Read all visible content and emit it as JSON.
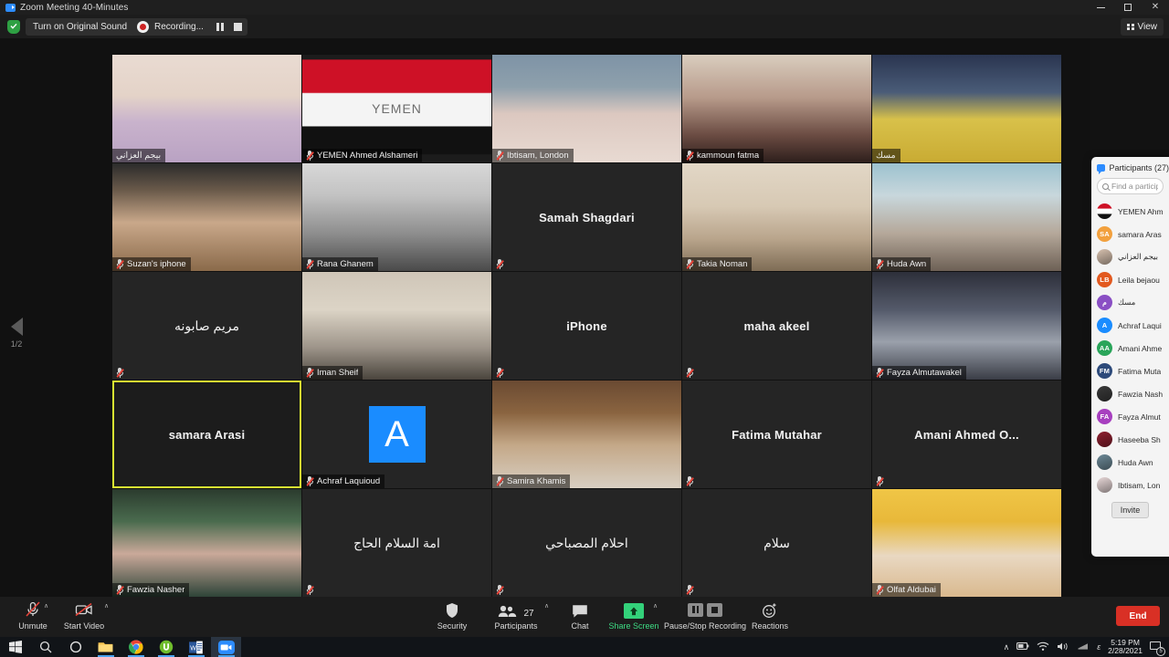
{
  "window": {
    "title": "Zoom Meeting 40-Minutes",
    "minimize_label": "Minimize",
    "maximize_label": "Restore",
    "close_label": "Close"
  },
  "top_toolbar": {
    "original_sound_label": "Turn on Original Sound",
    "original_sound_caret": "▾",
    "recording_label": "Recording...",
    "view_label": "View"
  },
  "stage": {
    "page_indicator": "1/2",
    "prev_page_label": "Previous page"
  },
  "tiles": [
    {
      "name": "بيجم العزاني",
      "rtl": true,
      "display": "bar",
      "muted": false,
      "video": true,
      "theme": "photo-a"
    },
    {
      "name": "YEMEN Ahmed Alshameri",
      "rtl": false,
      "display": "bar",
      "muted": true,
      "video": true,
      "theme": "yemen-flag"
    },
    {
      "name": "Ibtisam, London",
      "rtl": false,
      "display": "bar",
      "muted": true,
      "video": true,
      "theme": "photo-b"
    },
    {
      "name": "kammoun fatma",
      "rtl": false,
      "display": "bar",
      "muted": true,
      "video": true,
      "theme": "photo-c"
    },
    {
      "name": "مسك",
      "rtl": true,
      "display": "bar",
      "muted": false,
      "video": true,
      "theme": "photo-d"
    },
    {
      "name": "Suzan's iphone",
      "rtl": false,
      "display": "bar",
      "muted": true,
      "video": true,
      "theme": "photo-e"
    },
    {
      "name": "Rana Ghanem",
      "rtl": false,
      "display": "bar",
      "muted": true,
      "video": true,
      "theme": "photo-f"
    },
    {
      "name": "Samah Shagdari",
      "rtl": false,
      "display": "center",
      "muted": true,
      "video": false,
      "theme": "dark"
    },
    {
      "name": "Takia Noman",
      "rtl": false,
      "display": "bar",
      "muted": true,
      "video": true,
      "theme": "photo-g"
    },
    {
      "name": "Huda Awn",
      "rtl": false,
      "display": "bar",
      "muted": true,
      "video": true,
      "theme": "photo-h"
    },
    {
      "name": "مريم صابونه",
      "rtl": true,
      "display": "center",
      "muted": true,
      "video": false,
      "theme": "dark"
    },
    {
      "name": "Iman Sheif",
      "rtl": false,
      "display": "bar",
      "muted": true,
      "video": true,
      "theme": "photo-i"
    },
    {
      "name": "iPhone",
      "rtl": false,
      "display": "center",
      "muted": true,
      "video": false,
      "theme": "dark"
    },
    {
      "name": "maha akeel",
      "rtl": false,
      "display": "center",
      "muted": true,
      "video": false,
      "theme": "dark"
    },
    {
      "name": "Fayza Almutawakel",
      "rtl": false,
      "display": "bar",
      "muted": true,
      "video": true,
      "theme": "photo-j"
    },
    {
      "name": "samara Arasi",
      "rtl": false,
      "display": "center",
      "muted": false,
      "video": false,
      "theme": "dark",
      "active": true
    },
    {
      "name": "Achraf Laquioud",
      "rtl": false,
      "display": "bar",
      "muted": true,
      "video": false,
      "theme": "letter",
      "letter": "A"
    },
    {
      "name": "Samira Khamis",
      "rtl": false,
      "display": "bar",
      "muted": true,
      "video": true,
      "theme": "photo-k"
    },
    {
      "name": "Fatima Mutahar",
      "rtl": false,
      "display": "center",
      "muted": true,
      "video": false,
      "theme": "dark"
    },
    {
      "name": "Amani  Ahmed  O...",
      "rtl": false,
      "display": "center",
      "muted": true,
      "video": false,
      "theme": "dark"
    },
    {
      "name": "Fawzia Nasher",
      "rtl": false,
      "display": "bar",
      "muted": true,
      "video": true,
      "theme": "photo-l"
    },
    {
      "name": "امة السلام الحاج",
      "rtl": true,
      "display": "center",
      "muted": true,
      "video": false,
      "theme": "dark"
    },
    {
      "name": "احلام المصباحي",
      "rtl": true,
      "display": "center",
      "muted": true,
      "video": false,
      "theme": "dark"
    },
    {
      "name": "سلام",
      "rtl": true,
      "display": "center",
      "muted": true,
      "video": false,
      "theme": "dark"
    },
    {
      "name": "Olfat Aldubai",
      "rtl": false,
      "display": "bar",
      "muted": true,
      "video": true,
      "theme": "photo-m"
    }
  ],
  "participants_panel": {
    "title": "Participants (27)",
    "search_placeholder": "Find a particip",
    "invite_label": "Invite",
    "list": [
      {
        "name": "YEMEN Ahm",
        "initials": "",
        "color": "#cf2027",
        "rtl": false,
        "avatar": "flag"
      },
      {
        "name": "samara Aras",
        "initials": "SA",
        "color": "#f2a03d",
        "rtl": false,
        "avatar": "initials"
      },
      {
        "name": "بيجم العزاني",
        "initials": "",
        "color": "#d8c2b0",
        "rtl": true,
        "avatar": "photo"
      },
      {
        "name": "Leila bejaou",
        "initials": "LB",
        "color": "#e2591f",
        "rtl": false,
        "avatar": "initials"
      },
      {
        "name": "مسك",
        "initials": "م",
        "color": "#8a4fc4",
        "rtl": true,
        "avatar": "initials"
      },
      {
        "name": "Achraf Laqui",
        "initials": "A",
        "color": "#1a8cff",
        "rtl": false,
        "avatar": "initials"
      },
      {
        "name": "Amani Ahme",
        "initials": "AA",
        "color": "#2aa55a",
        "rtl": false,
        "avatar": "initials"
      },
      {
        "name": "Fatima Muta",
        "initials": "FM",
        "color": "#2d4a7a",
        "rtl": false,
        "avatar": "initials"
      },
      {
        "name": "Fawzia Nash",
        "initials": "",
        "color": "#3a3a3a",
        "rtl": false,
        "avatar": "photo"
      },
      {
        "name": "Fayza Almut",
        "initials": "FA",
        "color": "#a73fbf",
        "rtl": false,
        "avatar": "initials"
      },
      {
        "name": "Haseeba Sh",
        "initials": "",
        "color": "#8f2030",
        "rtl": false,
        "avatar": "photo"
      },
      {
        "name": "Huda Awn",
        "initials": "",
        "color": "#6d8a98",
        "rtl": false,
        "avatar": "photo"
      },
      {
        "name": "Ibtisam, Lon",
        "initials": "",
        "color": "#e8d8d8",
        "rtl": false,
        "avatar": "photo"
      }
    ]
  },
  "bottom_toolbar": {
    "mute_label": "Unmute",
    "video_label": "Start Video",
    "security_label": "Security",
    "participants_label": "Participants",
    "participants_count": "27",
    "chat_label": "Chat",
    "share_label": "Share Screen",
    "recording_label": "Pause/Stop Recording",
    "reactions_label": "Reactions",
    "end_label": "End",
    "caret": "∧"
  },
  "taskbar": {
    "start_label": "Start",
    "search_label": "Search",
    "cortana_label": "Cortana",
    "explorer_label": "File Explorer",
    "chrome_label": "Google Chrome",
    "utorrent_label": "uTorrent",
    "word_label": "Microsoft Word",
    "zoom_label": "Zoom",
    "tray_chevron": "∧",
    "time": "5:19 PM",
    "date": "2/28/2021",
    "notification_count": "5"
  }
}
